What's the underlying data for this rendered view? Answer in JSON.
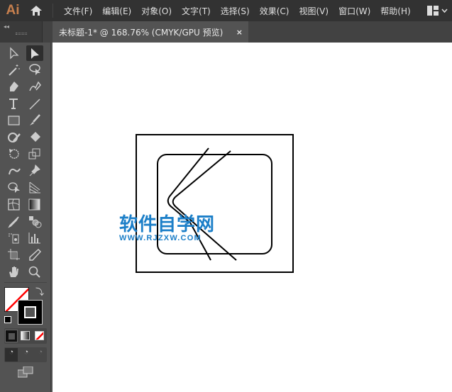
{
  "app": {
    "logo": "Ai"
  },
  "menu": [
    "文件(F)",
    "编辑(E)",
    "对象(O)",
    "文字(T)",
    "选择(S)",
    "效果(C)",
    "视图(V)",
    "窗口(W)",
    "帮助(H)"
  ],
  "document_tab": {
    "title": "未标题-1* @ 168.76% (CMYK/GPU 预览)",
    "close": "×"
  },
  "toolbar": {
    "tools": [
      "selection",
      "direct-selection",
      "magic-wand",
      "lasso",
      "pen",
      "curvature",
      "type",
      "line-segment",
      "rectangle",
      "paintbrush",
      "shaper",
      "eraser",
      "rotate",
      "scale",
      "puppet-warp",
      "pin",
      "shape-builder",
      "perspective-grid",
      "mesh",
      "gradient",
      "eyedropper",
      "blend",
      "symbol-sprayer",
      "column-graph",
      "artboard",
      "slice",
      "hand",
      "zoom"
    ],
    "active": "direct-selection",
    "fill": "none",
    "stroke": "#000000"
  },
  "watermark": {
    "line1": "软件自学网",
    "line2": "WWW.RJZXW.COM",
    "color": "#1c7fc8"
  }
}
